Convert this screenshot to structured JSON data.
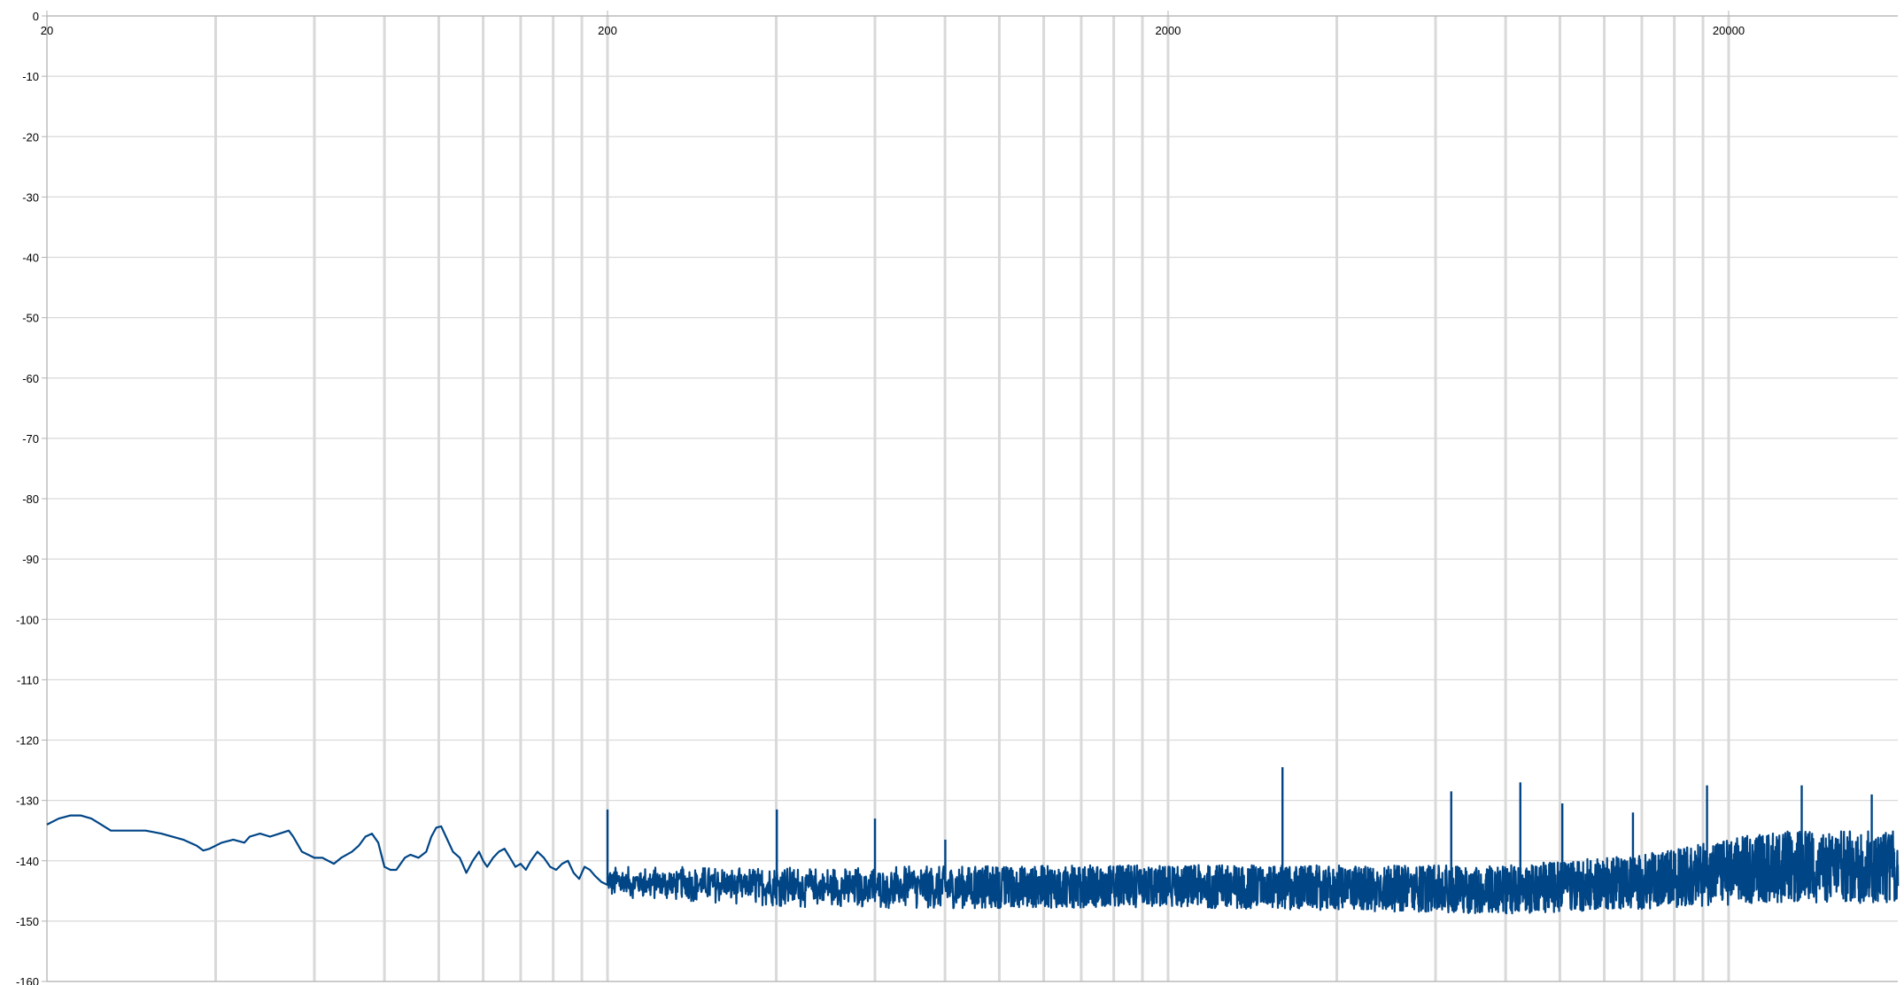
{
  "chart_data": {
    "type": "line",
    "title": "",
    "xlabel": "",
    "ylabel": "",
    "x_scale": "log",
    "xlim": [
      20,
      24000
    ],
    "ylim": [
      -160,
      0
    ],
    "x_tick_labels": [
      "20",
      "200",
      "2000",
      "20000"
    ],
    "x_tick_values": [
      20,
      200,
      2000,
      20000
    ],
    "y_ticks": [
      0,
      -10,
      -20,
      -30,
      -40,
      -50,
      -60,
      -70,
      -80,
      -90,
      -100,
      -110,
      -120,
      -130,
      -140,
      -150,
      -160
    ],
    "y_tick_labels": [
      "0",
      "-10",
      "-20",
      "-30",
      "-40",
      "-50",
      "-60",
      "-70",
      "-80",
      "-90",
      "-100",
      "-110",
      "-120",
      "-130",
      "-140",
      "-150",
      "-160"
    ],
    "grid": true,
    "legend": "none",
    "colors": {
      "line": "#004586",
      "grid": "#d9d9d9",
      "axis": "#b3b3b3"
    },
    "noise_floor": [
      [
        20,
        -134
      ],
      [
        21,
        -133
      ],
      [
        22,
        -132.5
      ],
      [
        23,
        -132.5
      ],
      [
        24,
        -133
      ],
      [
        25,
        -134
      ],
      [
        26,
        -135
      ],
      [
        28,
        -135
      ],
      [
        30,
        -135
      ],
      [
        32,
        -135.5
      ],
      [
        35,
        -136.5
      ],
      [
        37,
        -137.5
      ],
      [
        38,
        -138.3
      ],
      [
        39,
        -138
      ],
      [
        41,
        -137
      ],
      [
        43,
        -136.5
      ],
      [
        45,
        -137
      ],
      [
        46,
        -136
      ],
      [
        48,
        -135.5
      ],
      [
        50,
        -136
      ],
      [
        52,
        -135.5
      ],
      [
        54,
        -135
      ],
      [
        55,
        -136
      ],
      [
        57,
        -138.5
      ],
      [
        60,
        -139.5
      ],
      [
        62,
        -139.5
      ],
      [
        65,
        -140.5
      ],
      [
        67,
        -139.5
      ],
      [
        70,
        -138.5
      ],
      [
        72,
        -137.5
      ],
      [
        74,
        -136
      ],
      [
        76,
        -135.5
      ],
      [
        78,
        -137
      ],
      [
        80,
        -141
      ],
      [
        82,
        -141.5
      ],
      [
        84,
        -141.5
      ],
      [
        87,
        -139.5
      ],
      [
        89,
        -139
      ],
      [
        92,
        -139.5
      ],
      [
        95,
        -138.5
      ],
      [
        97,
        -136
      ],
      [
        99,
        -134.5
      ],
      [
        101,
        -134.3
      ],
      [
        103,
        -136
      ],
      [
        106,
        -138.5
      ],
      [
        109,
        -139.5
      ],
      [
        112,
        -142
      ],
      [
        115,
        -140
      ],
      [
        118,
        -138.5
      ],
      [
        120,
        -140
      ],
      [
        122,
        -141
      ],
      [
        125,
        -139.5
      ],
      [
        128,
        -138.5
      ],
      [
        131,
        -138
      ],
      [
        134,
        -139.5
      ],
      [
        137,
        -141
      ],
      [
        140,
        -140.5
      ],
      [
        143,
        -141.5
      ],
      [
        146,
        -140
      ],
      [
        150,
        -138.5
      ],
      [
        154,
        -139.5
      ],
      [
        158,
        -141
      ],
      [
        162,
        -141.5
      ],
      [
        166,
        -140.5
      ],
      [
        170,
        -140
      ],
      [
        174,
        -142
      ],
      [
        178,
        -143
      ],
      [
        182,
        -141
      ],
      [
        186,
        -141.5
      ],
      [
        190,
        -142.5
      ],
      [
        195,
        -143.5
      ],
      [
        200,
        -144
      ]
    ],
    "noise_band": {
      "x_start": 200,
      "x_end": 24000,
      "center_db": [
        [
          200,
          -143.5
        ],
        [
          500,
          -144.5
        ],
        [
          2000,
          -144.2
        ],
        [
          8000,
          -144.8
        ],
        [
          14000,
          -143.5
        ],
        [
          24000,
          -141
        ]
      ],
      "half_width_db": [
        [
          200,
          2.5
        ],
        [
          500,
          3.5
        ],
        [
          2000,
          3.5
        ],
        [
          8000,
          4
        ],
        [
          14000,
          4.5
        ],
        [
          24000,
          6
        ]
      ]
    },
    "harmonic_peaks": [
      {
        "freq": 200,
        "db": -131.5
      },
      {
        "freq": 401,
        "db": -131.5
      },
      {
        "freq": 600,
        "db": -133
      },
      {
        "freq": 801,
        "db": -136.5
      },
      {
        "freq": 3200,
        "db": -124.5
      },
      {
        "freq": 6400,
        "db": -128.5
      },
      {
        "freq": 8500,
        "db": -127
      },
      {
        "freq": 10100,
        "db": -130.5
      },
      {
        "freq": 13500,
        "db": -132
      },
      {
        "freq": 16800,
        "db": -138.5
      },
      {
        "freq": 18300,
        "db": -127.5
      },
      {
        "freq": 20600,
        "db": -137
      },
      {
        "freq": 27000,
        "db": -127.5
      },
      {
        "freq": 36000,
        "db": -129
      }
    ]
  }
}
